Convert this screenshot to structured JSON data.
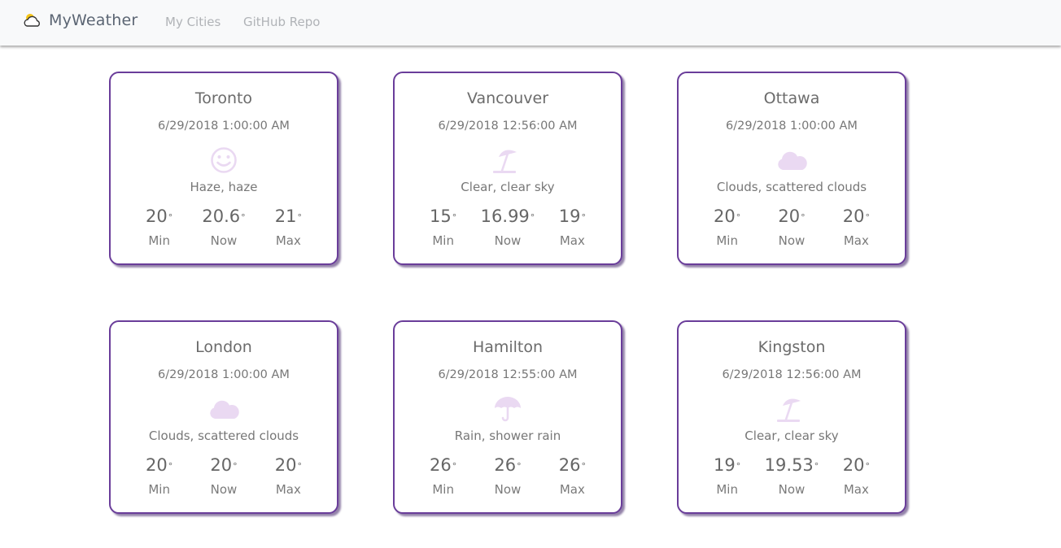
{
  "nav": {
    "brand": "MyWeather",
    "brand_icon": "sun-behind-cloud-icon",
    "links": [
      "My Cities",
      "GitHub Repo"
    ]
  },
  "colors": {
    "card_border": "#6a3d9a",
    "icon_tint": "#ead9f2",
    "brand_sun": "#f5c518"
  },
  "labels": {
    "min": "Min",
    "now": "Now",
    "max": "Max",
    "degree": "°"
  },
  "cards": [
    {
      "city": "Toronto",
      "date": "6/29/2018 1:00:00 AM",
      "icon": "smile-icon",
      "desc": "Haze, haze",
      "min": "20",
      "now": "20.6",
      "max": "21"
    },
    {
      "city": "Vancouver",
      "date": "6/29/2018 12:56:00 AM",
      "icon": "beach-umbrella-icon",
      "desc": "Clear, clear sky",
      "min": "15",
      "now": "16.99",
      "max": "19"
    },
    {
      "city": "Ottawa",
      "date": "6/29/2018 1:00:00 AM",
      "icon": "cloud-icon",
      "desc": "Clouds, scattered clouds",
      "min": "20",
      "now": "20",
      "max": "20"
    },
    {
      "city": "London",
      "date": "6/29/2018 1:00:00 AM",
      "icon": "cloud-icon",
      "desc": "Clouds, scattered clouds",
      "min": "20",
      "now": "20",
      "max": "20"
    },
    {
      "city": "Hamilton",
      "date": "6/29/2018 12:55:00 AM",
      "icon": "umbrella-icon",
      "desc": "Rain, shower rain",
      "min": "26",
      "now": "26",
      "max": "26"
    },
    {
      "city": "Kingston",
      "date": "6/29/2018 12:56:00 AM",
      "icon": "beach-umbrella-icon",
      "desc": "Clear, clear sky",
      "min": "19",
      "now": "19.53",
      "max": "20"
    }
  ]
}
